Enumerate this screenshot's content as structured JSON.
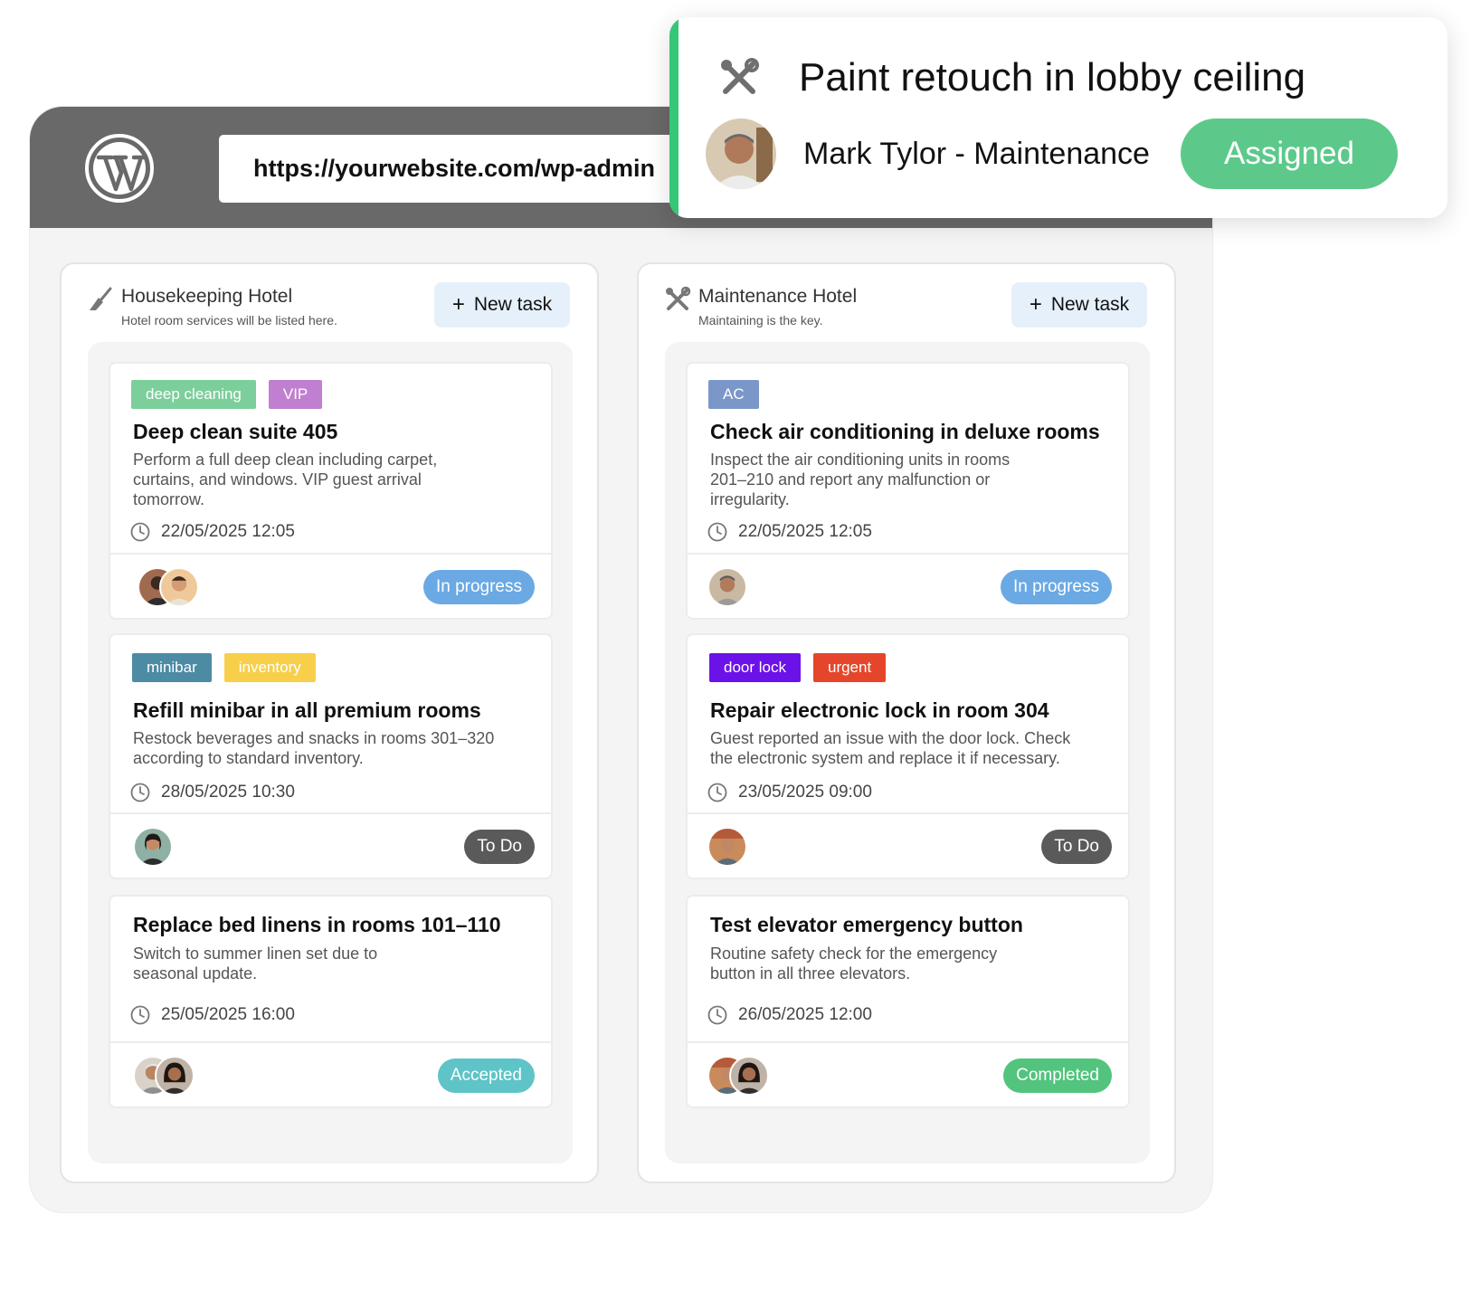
{
  "browser": {
    "url": "https://yourwebsite.com/wp-admin"
  },
  "notification": {
    "title": "Paint retouch in lobby ceiling",
    "user": "Mark Tylor - Maintenance",
    "status": "Assigned",
    "icon": "tools-icon",
    "accent_color": "#35c777",
    "status_color": "#5cc98a"
  },
  "columns": [
    {
      "title": "Housekeeping Hotel",
      "subtitle": "Hotel room services will be listed here.",
      "icon": "broom-icon",
      "new_task_label": "New task",
      "cards": [
        {
          "tags": [
            {
              "label": "deep cleaning",
              "color": "#7ccf9b"
            },
            {
              "label": "VIP",
              "color": "#c07fd0"
            }
          ],
          "title": "Deep clean suite 405",
          "description": "Perform a full deep clean including carpet, curtains, and windows. VIP guest arrival tomorrow.",
          "date": "22/05/2025 12:05",
          "status": "In progress",
          "status_color": "#6aa9e4"
        },
        {
          "tags": [
            {
              "label": "minibar",
              "color": "#4d8aa3"
            },
            {
              "label": "inventory",
              "color": "#f7cf4a"
            }
          ],
          "title": "Refill minibar in all premium rooms",
          "description": "Restock beverages and snacks in rooms 301–320 according to standard inventory.",
          "date": "28/05/2025 10:30",
          "status": "To Do",
          "status_color": "#5a5a5a"
        },
        {
          "tags": [],
          "title": "Replace bed linens in rooms 101–110",
          "description": "Switch to summer linen set due to seasonal update.",
          "date": "25/05/2025 16:00",
          "status": "Accepted",
          "status_color": "#5ec4c7"
        }
      ]
    },
    {
      "title": "Maintenance Hotel",
      "subtitle": "Maintaining is the key.",
      "icon": "tools-icon",
      "new_task_label": "New task",
      "cards": [
        {
          "tags": [
            {
              "label": "AC",
              "color": "#7b97c9"
            }
          ],
          "title": "Check air conditioning in deluxe rooms",
          "description": "Inspect the air conditioning units in rooms 201–210 and report any malfunction or irregularity.",
          "date": "22/05/2025 12:05",
          "status": "In progress",
          "status_color": "#6aa9e4"
        },
        {
          "tags": [
            {
              "label": "door lock",
              "color": "#6b12e8"
            },
            {
              "label": "urgent",
              "color": "#e5462b"
            }
          ],
          "title": "Repair electronic lock in room 304",
          "description": "Guest reported an issue with the door lock. Check the electronic system and replace it if necessary.",
          "date": "23/05/2025 09:00",
          "status": "To Do",
          "status_color": "#5a5a5a"
        },
        {
          "tags": [],
          "title": "Test elevator emergency button",
          "description": "Routine safety check for the emergency button in all three elevators.",
          "date": "26/05/2025 12:00",
          "status": "Completed",
          "status_color": "#52c47e"
        }
      ]
    }
  ]
}
